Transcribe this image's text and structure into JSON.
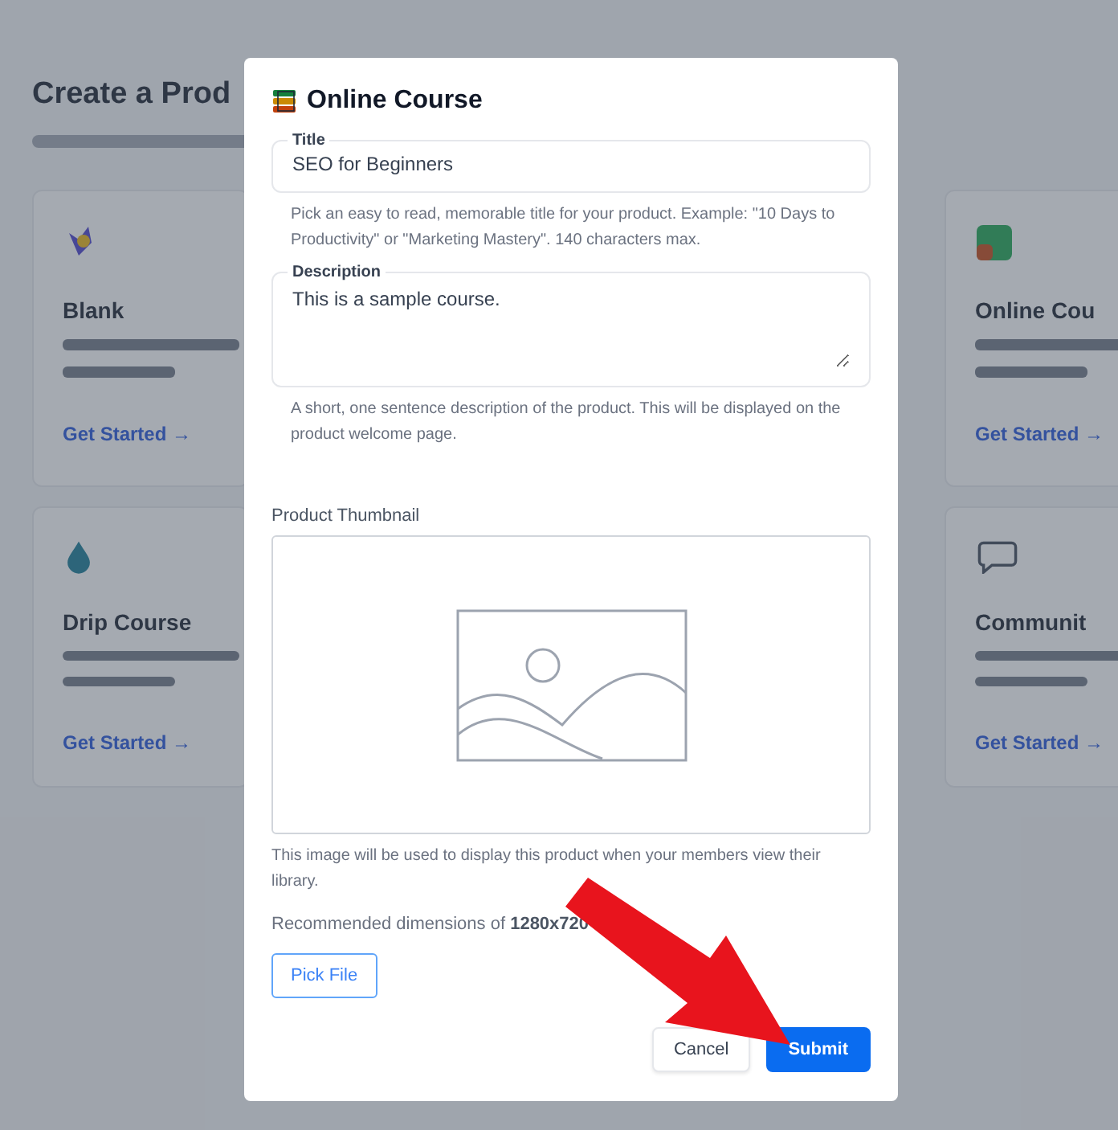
{
  "page": {
    "title": "Create a Prod",
    "cards": [
      {
        "kind": "blank",
        "title": "Blank",
        "link": "Get Started →"
      },
      {
        "kind": "drip",
        "title": "Drip Course",
        "link": "Get Started →"
      },
      {
        "kind": "course",
        "title": "Online Cou",
        "link": "Get Started →"
      },
      {
        "kind": "community",
        "title": "Communit",
        "link": "Get Started →"
      }
    ]
  },
  "dialog": {
    "title": "Online Course",
    "title_field": {
      "label": "Title",
      "value": "SEO for Beginners",
      "hint": "Pick an easy to read, memorable title for your product. Example: \"10 Days to Productivity\" or \"Marketing Mastery\". 140 characters max."
    },
    "description_field": {
      "label": "Description",
      "value": "This is a sample course.",
      "hint": "A short, one sentence description of the product. This will be displayed on the product welcome page."
    },
    "thumbnail": {
      "label": "Product Thumbnail",
      "hint": "This image will be used to display this product when your members view their library.",
      "dimensions": "Recommended dimensions of **1280x720**",
      "pick_button": "Pick File"
    },
    "buttons": {
      "cancel": "Cancel",
      "submit": "Submit"
    }
  }
}
